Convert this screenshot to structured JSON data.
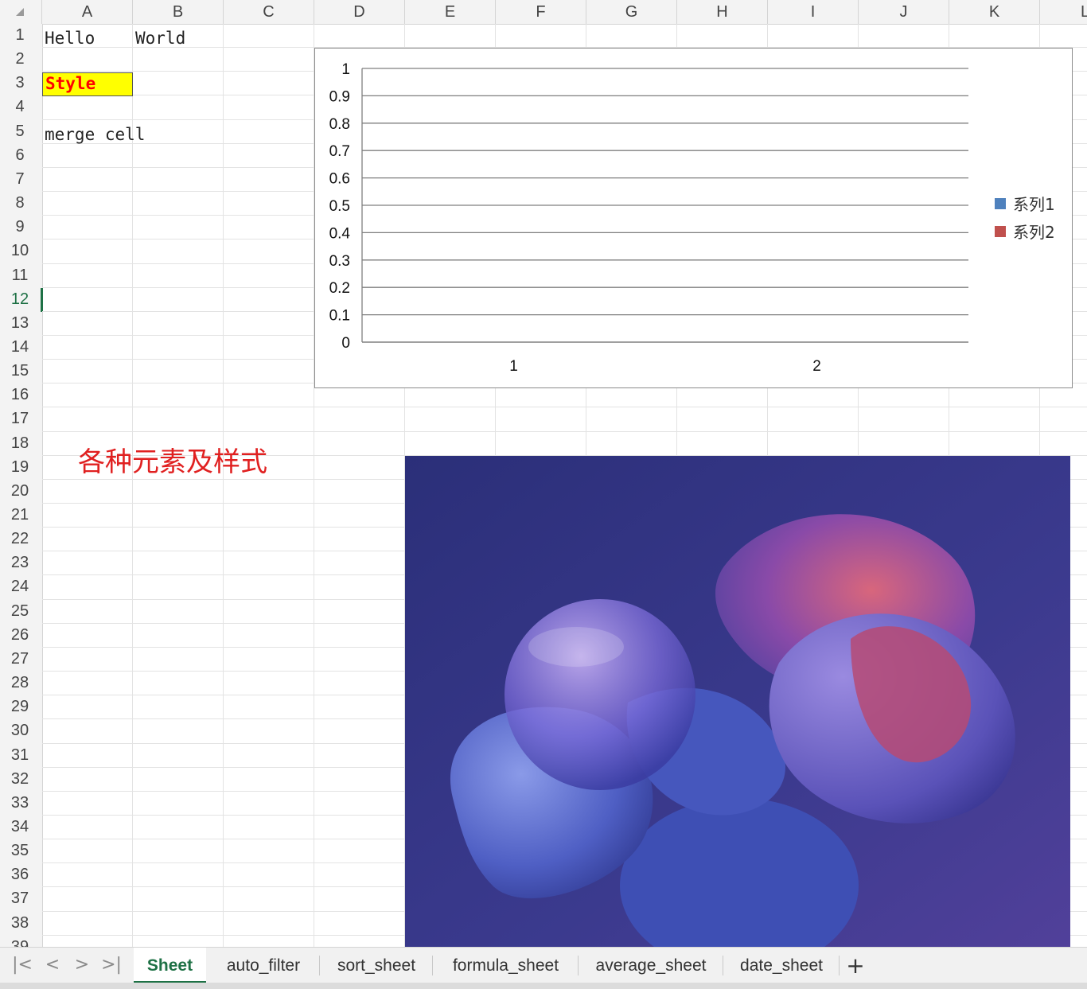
{
  "columns": [
    "A",
    "B",
    "C",
    "D",
    "E",
    "F",
    "G",
    "H",
    "I",
    "J",
    "K",
    "L"
  ],
  "rows": [
    "1",
    "2",
    "3",
    "4",
    "5",
    "6",
    "7",
    "8",
    "9",
    "10",
    "11",
    "12",
    "13",
    "14",
    "15",
    "16",
    "17",
    "18",
    "19",
    "20",
    "21",
    "22",
    "23",
    "24",
    "25",
    "26",
    "27",
    "28",
    "29",
    "30",
    "31",
    "32",
    "33",
    "34",
    "35",
    "36",
    "37",
    "38",
    "39"
  ],
  "active_row": "12",
  "cells": {
    "A1": "Hello",
    "B1": "World",
    "A3": "Style",
    "A5": "merge cell",
    "title_text": "各种元素及样式"
  },
  "colors": {
    "accent": "#1e7145",
    "style_fill": "#ffff00",
    "style_text": "#ff0000",
    "title_text": "#e02020"
  },
  "chart_data": {
    "type": "bar",
    "categories": [
      "1",
      "2"
    ],
    "series": [
      {
        "name": "系列1",
        "color": "#4f81bd",
        "values": [
          0,
          0
        ]
      },
      {
        "name": "系列2",
        "color": "#c0504d",
        "values": [
          0,
          0
        ]
      }
    ],
    "y_ticks": [
      "0",
      "0.1",
      "0.2",
      "0.3",
      "0.4",
      "0.5",
      "0.6",
      "0.7",
      "0.8",
      "0.9",
      "1"
    ],
    "ylim": [
      0,
      1
    ],
    "grid": true,
    "legend_position": "right"
  },
  "tabs": [
    {
      "label": "Sheet",
      "active": true
    },
    {
      "label": "auto_filter",
      "active": false
    },
    {
      "label": "sort_sheet",
      "active": false
    },
    {
      "label": "formula_sheet",
      "active": false
    },
    {
      "label": "average_sheet",
      "active": false
    },
    {
      "label": "date_sheet",
      "active": false
    }
  ],
  "tab_nav": {
    "first": "|<",
    "prev": "<",
    "next": ">",
    "last": ">|",
    "add": "+"
  }
}
